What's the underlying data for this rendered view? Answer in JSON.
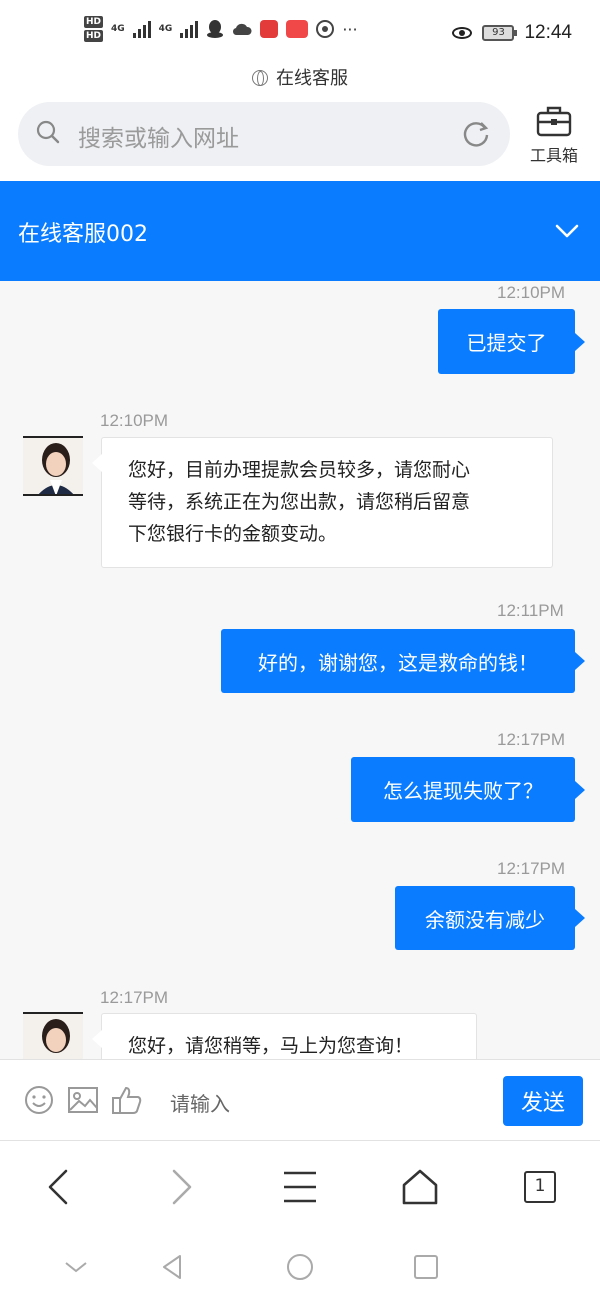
{
  "status_bar": {
    "hd1": "HD",
    "hd2": "HD",
    "net1": "4G",
    "net2": "4G",
    "battery": "93",
    "time": "12:44"
  },
  "browser": {
    "page_title": "在线客服",
    "search_placeholder": "搜索或输入网址",
    "toolbox_label": "工具箱",
    "tab_count": "1"
  },
  "chat": {
    "header_title": "在线客服002",
    "messages": [
      {
        "direction": "outgoing",
        "time": "12:10PM",
        "text": "已提交了"
      },
      {
        "direction": "incoming",
        "time": "12:10PM",
        "lines": [
          "您好，目前办理提款会员较多，请您耐心",
          "等待，系统正在为您出款，请您稍后留意",
          "下您银行卡的金额变动。"
        ]
      },
      {
        "direction": "outgoing",
        "time": "12:11PM",
        "text": "好的，谢谢您，这是救命的钱！"
      },
      {
        "direction": "outgoing",
        "time": "12:17PM",
        "text": "怎么提现失败了？"
      },
      {
        "direction": "outgoing",
        "time": "12:17PM",
        "text": "余额没有减少"
      },
      {
        "direction": "incoming",
        "time": "12:17PM",
        "lines": [
          "您好，请您稍等，马上为您查询！"
        ]
      }
    ]
  },
  "input_bar": {
    "placeholder": "请输入",
    "send_label": "发送"
  },
  "colors": {
    "accent": "#0a7cff",
    "chat_bg": "#f7f7f8"
  }
}
